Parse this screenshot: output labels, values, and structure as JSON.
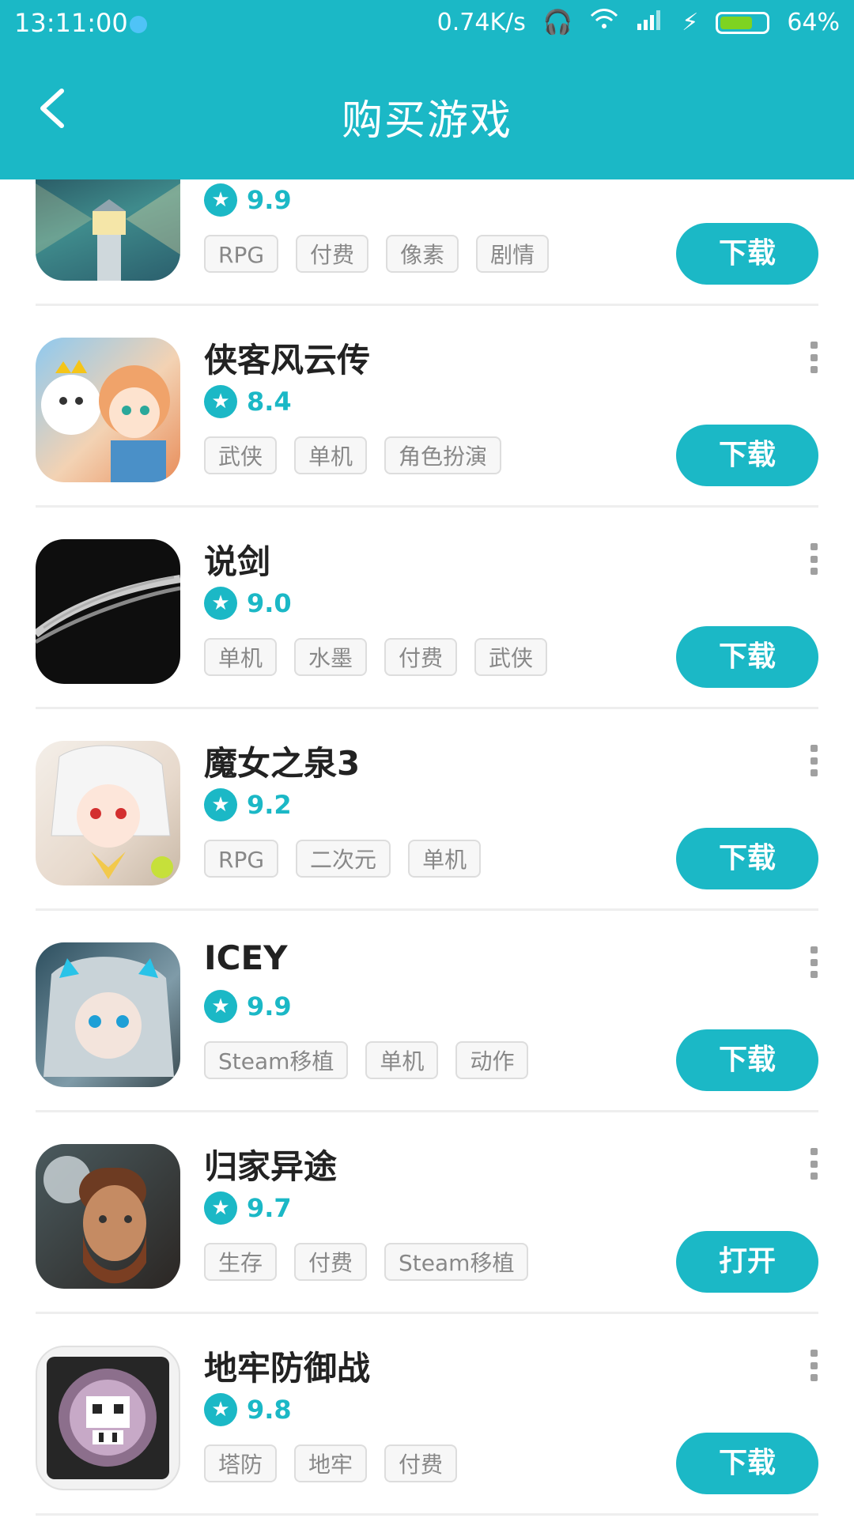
{
  "status": {
    "time": "13:11:00",
    "net_speed": "0.74K/s",
    "battery": "64%",
    "battery_level": 0.64,
    "icons": [
      "headphone-icon",
      "wifi-icon",
      "signal-icon",
      "charging-icon",
      "battery-icon"
    ]
  },
  "header": {
    "title": "购买游戏",
    "back_icon": "chevron-left-icon"
  },
  "colors": {
    "accent": "#1bb8c6",
    "tag_bg": "#f7f7f7",
    "tag_text": "#888888"
  },
  "games": [
    {
      "name": "",
      "score": "9.9",
      "tags": [
        "RPG",
        "付费",
        "像素",
        "剧情"
      ],
      "action": "下载",
      "icon_color": "#2b5f6d"
    },
    {
      "name": "侠客风云传",
      "score": "8.4",
      "tags": [
        "武侠",
        "单机",
        "角色扮演"
      ],
      "action": "下载",
      "icon_color": "#e8b98a"
    },
    {
      "name": "说剑",
      "score": "9.0",
      "tags": [
        "单机",
        "水墨",
        "付费",
        "武侠"
      ],
      "action": "下载",
      "icon_color": "#111111"
    },
    {
      "name": "魔女之泉3",
      "score": "9.2",
      "tags": [
        "RPG",
        "二次元",
        "单机"
      ],
      "action": "下载",
      "icon_color": "#efe7df"
    },
    {
      "name": "ICEY",
      "score": "9.9",
      "tags": [
        "Steam移植",
        "单机",
        "动作"
      ],
      "action": "下载",
      "icon_color": "#5f7d8c"
    },
    {
      "name": "归家异途",
      "score": "9.7",
      "tags": [
        "生存",
        "付费",
        "Steam移植"
      ],
      "action": "打开",
      "icon_color": "#3a3430"
    },
    {
      "name": "地牢防御战",
      "score": "9.8",
      "tags": [
        "塔防",
        "地牢",
        "付费"
      ],
      "action": "下载",
      "icon_color": "#2a2a2a"
    }
  ]
}
